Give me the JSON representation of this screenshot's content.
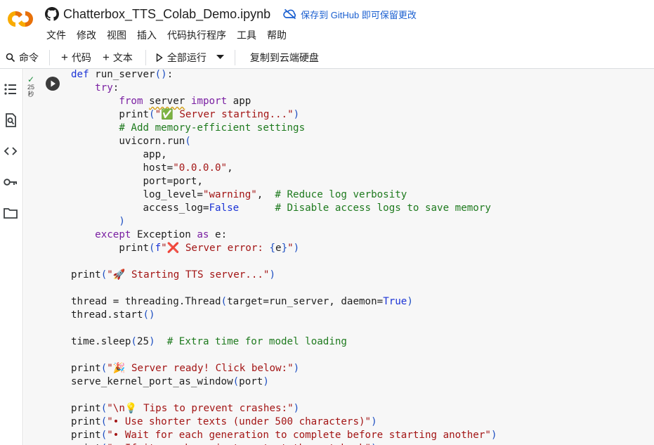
{
  "header": {
    "notebook_title": "Chatterbox_TTS_Colab_Demo.ipynb",
    "save_to_github": "保存到 GitHub 即可保留更改",
    "logo_icon": "colab-logo",
    "menu": [
      "文件",
      "修改",
      "视图",
      "插入",
      "代码执行程序",
      "工具",
      "帮助"
    ]
  },
  "toolbar": {
    "commands": "命令",
    "add_code": "代码",
    "add_text": "文本",
    "run_all": "全部运行",
    "copy_to_drive": "复制到云端硬盘"
  },
  "rail": [
    "toc-icon",
    "find-icon",
    "code-snippets-icon",
    "secrets-key-icon",
    "files-folder-icon"
  ],
  "cell": {
    "status_check": "✓",
    "exec_time": "25",
    "exec_unit": "秒"
  },
  "code_lines": [
    [
      [
        "kb",
        "def"
      ],
      [
        "fn",
        " run_server"
      ],
      [
        "br",
        "()"
      ],
      [
        "fn",
        ":"
      ]
    ],
    [
      [
        "fn",
        "    "
      ],
      [
        "kw",
        "try"
      ],
      [
        "fn",
        ":"
      ]
    ],
    [
      [
        "fn",
        "        "
      ],
      [
        "kw",
        "from"
      ],
      [
        "fn",
        " "
      ],
      [
        "squig",
        "server"
      ],
      [
        "fn",
        " "
      ],
      [
        "kw",
        "import"
      ],
      [
        "fn",
        " app"
      ]
    ],
    [
      [
        "fn",
        "        print"
      ],
      [
        "br",
        "("
      ],
      [
        "str",
        "\"✅ Server starting...\""
      ],
      [
        "br",
        ")"
      ]
    ],
    [
      [
        "fn",
        "        "
      ],
      [
        "com",
        "# Add memory-efficient settings"
      ]
    ],
    [
      [
        "fn",
        "        uvicorn.run"
      ],
      [
        "br",
        "("
      ]
    ],
    [
      [
        "fn",
        "            app,"
      ]
    ],
    [
      [
        "fn",
        "            host="
      ],
      [
        "str",
        "\"0.0.0.0\""
      ],
      [
        "fn",
        ","
      ]
    ],
    [
      [
        "fn",
        "            port=port,"
      ]
    ],
    [
      [
        "fn",
        "            log_level="
      ],
      [
        "str",
        "\"warning\""
      ],
      [
        "fn",
        ",  "
      ],
      [
        "com",
        "# Reduce log verbosity"
      ]
    ],
    [
      [
        "fn",
        "            access_log="
      ],
      [
        "kb",
        "False"
      ],
      [
        "fn",
        "      "
      ],
      [
        "com",
        "# Disable access logs to save memory"
      ]
    ],
    [
      [
        "br",
        "        )"
      ]
    ],
    [
      [
        "fn",
        "    "
      ],
      [
        "kw",
        "except"
      ],
      [
        "fn",
        " Exception "
      ],
      [
        "kw",
        "as"
      ],
      [
        "fn",
        " e:"
      ]
    ],
    [
      [
        "fn",
        "        print"
      ],
      [
        "br",
        "("
      ],
      [
        "kb",
        "f"
      ],
      [
        "str",
        "\"❌ Server error: "
      ],
      [
        "br",
        "{"
      ],
      [
        "fn",
        "e"
      ],
      [
        "br",
        "}"
      ],
      [
        "str",
        "\""
      ],
      [
        "br",
        ")"
      ]
    ],
    [],
    [
      [
        "fn",
        "print"
      ],
      [
        "br",
        "("
      ],
      [
        "str",
        "\"🚀 Starting TTS server...\""
      ],
      [
        "br",
        ")"
      ]
    ],
    [],
    [
      [
        "fn",
        "thread = threading.Thread"
      ],
      [
        "br",
        "("
      ],
      [
        "fn",
        "target=run_server, daemon="
      ],
      [
        "kb",
        "True"
      ],
      [
        "br",
        ")"
      ]
    ],
    [
      [
        "fn",
        "thread.start"
      ],
      [
        "br",
        "()"
      ]
    ],
    [],
    [
      [
        "fn",
        "time.sleep"
      ],
      [
        "br",
        "("
      ],
      [
        "fn",
        "25"
      ],
      [
        "br",
        ")"
      ],
      [
        "fn",
        "  "
      ],
      [
        "com",
        "# Extra time for model loading"
      ]
    ],
    [],
    [
      [
        "fn",
        "print"
      ],
      [
        "br",
        "("
      ],
      [
        "str",
        "\"🎉 Server ready! Click below:\""
      ],
      [
        "br",
        ")"
      ]
    ],
    [
      [
        "fn",
        "serve_kernel_port_as_window"
      ],
      [
        "br",
        "("
      ],
      [
        "fn",
        "port"
      ],
      [
        "br",
        ")"
      ]
    ],
    [],
    [
      [
        "fn",
        "print"
      ],
      [
        "br",
        "("
      ],
      [
        "str",
        "\"\\n💡 Tips to prevent crashes:\""
      ],
      [
        "br",
        ")"
      ]
    ],
    [
      [
        "fn",
        "print"
      ],
      [
        "br",
        "("
      ],
      [
        "str",
        "\"• Use shorter texts (under 500 characters)\""
      ],
      [
        "br",
        ")"
      ]
    ],
    [
      [
        "fn",
        "print"
      ],
      [
        "br",
        "("
      ],
      [
        "str",
        "\"• Wait for each generation to complete before starting another\""
      ],
      [
        "br",
        ")"
      ]
    ],
    [
      [
        "fn",
        "print"
      ],
      [
        "br",
        "("
      ],
      [
        "str",
        "\"• If it crashes, just restart the notebook\""
      ],
      [
        "br",
        ")"
      ]
    ]
  ],
  "colors": {
    "keyword": "#7a1fa2",
    "builtin_keyword": "#1b33d6",
    "string": "#a31515",
    "comment": "#1e7a1e",
    "bracket": "#1e4fc2",
    "accent_link": "#1a5fd0",
    "logo_orange": "#f9ab00",
    "logo_dark_orange": "#e8710a"
  }
}
